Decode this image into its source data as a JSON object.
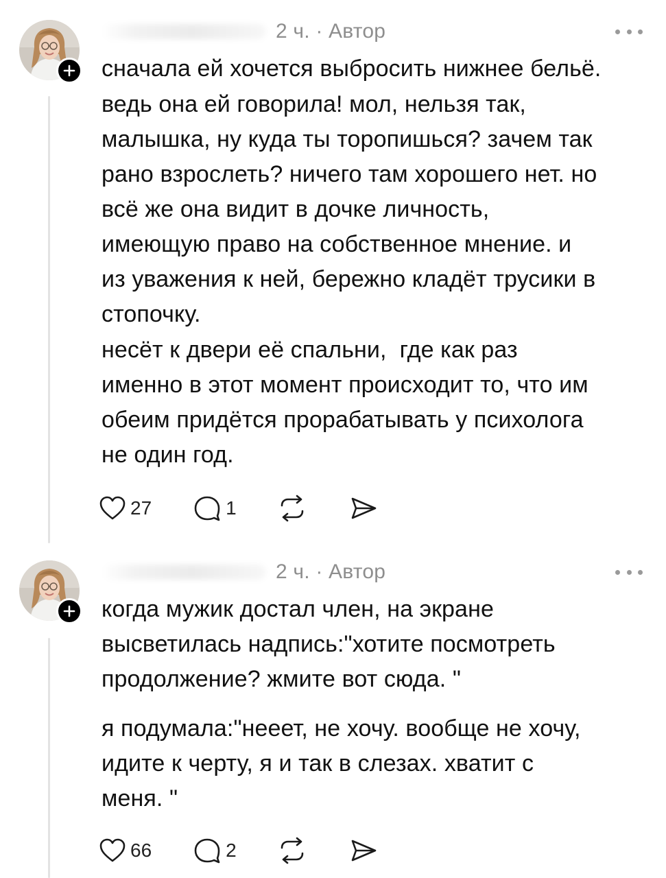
{
  "posts": [
    {
      "time_author": "2 ч. · Автор",
      "paragraphs": [
        "сначала ей хочется выбросить нижнее бельё.",
        "ведь она ей говорила! мол, нельзя так,\nмалышка, ну куда ты торопишься? зачем так\nрано взрослеть? ничего там хорошего нет. но\nвсё же она видит в дочке личность,\nимеющую право на собственное мнение. и\nиз уважения к ней, бережно кладёт трусики в\nстопочку.",
        "несёт к двери её спальни,  где как раз\nименно в этот момент происходит то, что им\nобеим придётся прорабатывать у психолога\nне один год."
      ],
      "likes": "27",
      "replies": "1"
    },
    {
      "time_author": "2 ч. · Автор",
      "paragraphs": [
        "когда мужик достал член, на экране\nвысветилась надпись:\"хотите посмотреть\nпродолжение? жмите вот сюда. \"",
        "я подумала:\"нееет, не хочу. вообще не хочу,\nидите к черту, я и так в слезах. хватит с\nменя. \""
      ],
      "likes": "66",
      "replies": "2"
    }
  ],
  "icons": {
    "like": "heart-icon",
    "reply": "comment-icon",
    "repost": "repost-icon",
    "share": "send-icon",
    "more": "more-dots-icon",
    "follow": "plus-icon"
  },
  "colors": {
    "meta": "#8e8e8e",
    "text": "#111111",
    "thread_line": "#e3e3e3",
    "badge": "#000000"
  }
}
